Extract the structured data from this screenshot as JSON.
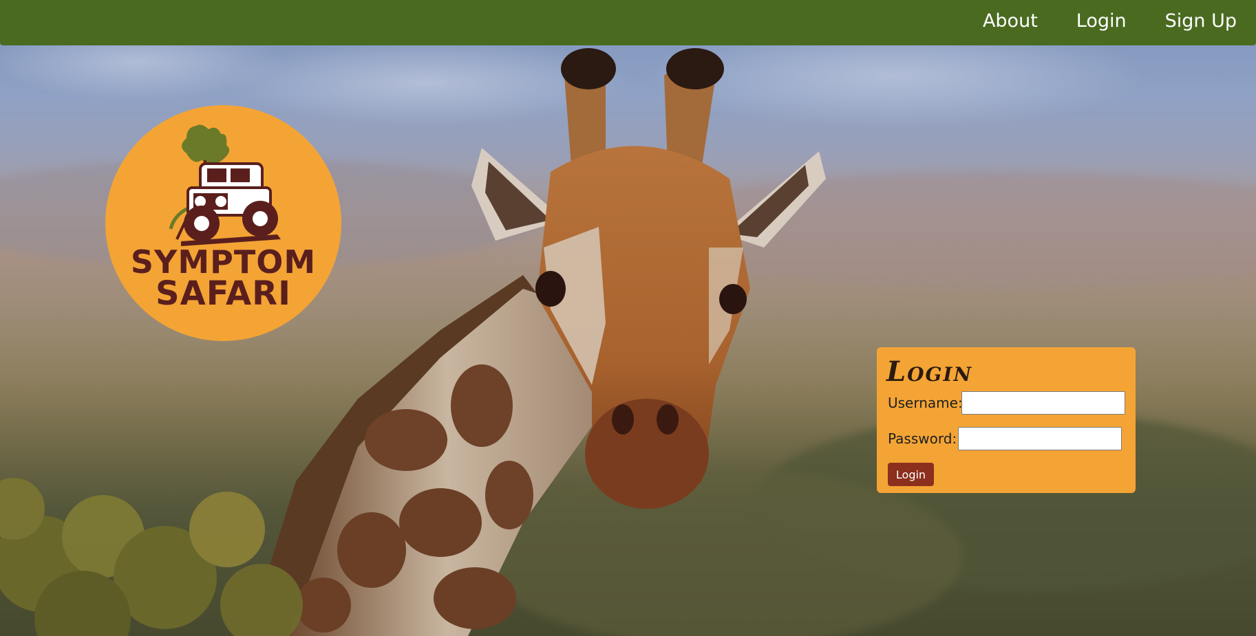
{
  "nav": {
    "items": [
      {
        "label": "About"
      },
      {
        "label": "Login"
      },
      {
        "label": "Sign Up"
      }
    ]
  },
  "logo": {
    "line1": "SYMPTOM",
    "line2": "SAFARI"
  },
  "login": {
    "title": "Login",
    "username_label": "Username:",
    "username_value": "",
    "password_label": "Password:",
    "password_value": "",
    "submit_label": "Login"
  },
  "colors": {
    "nav_bg": "#4a6a20",
    "accent": "#f4a435",
    "button": "#8c2f1d",
    "logo_text": "#5a1f1d"
  },
  "icons": {
    "logo_illustration": "safari-jeep-icon"
  }
}
